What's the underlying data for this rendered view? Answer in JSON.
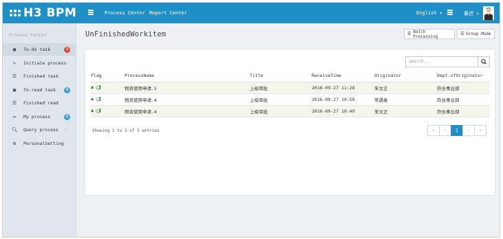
{
  "app": {
    "logo": "H3 BPM"
  },
  "topnav": {
    "process_center": "Process Center",
    "report_center": "Report Center",
    "language": "English",
    "user": "黄迟"
  },
  "sidebar": {
    "title": "Process Center",
    "items": [
      {
        "label": "To-do task",
        "badge": "3",
        "badge_color": "#e04b3a"
      },
      {
        "label": "Initiate process"
      },
      {
        "label": "Finished task"
      },
      {
        "label": "To-read task",
        "badge": "0",
        "badge_color": "#3aa5dc"
      },
      {
        "label": "Finished read"
      },
      {
        "label": "My process",
        "badge": "0",
        "badge_color": "#3aa5dc"
      },
      {
        "label": "Query process"
      },
      {
        "label": "PersonalSetting"
      }
    ]
  },
  "main": {
    "title": "UnFinishedWorkitem",
    "batch_label": "Batch Processing",
    "group_label": "Group Mode",
    "search_placeholder": "search..."
  },
  "table": {
    "headers": [
      "Flag",
      "ProcessName",
      "Title",
      "ReceiveTime",
      "Originator",
      "Dept.ofOriginator"
    ],
    "rows": [
      [
        "物资使用申请.5",
        "上级审批",
        "2016-09-27 11:28",
        "朱文正",
        "符合事业部"
      ],
      [
        "物资使用申请.4",
        "上级审批",
        "2016-09-27 10:50",
        "常遇春",
        "符合事业部"
      ],
      [
        "物资使用申请.4",
        "上级审批",
        "2016-09-27 10:49",
        "朱文正",
        "符合事业部"
      ]
    ]
  },
  "footer": {
    "info": "Showing 1 to 3 of 3 entries",
    "current_page": "1"
  }
}
